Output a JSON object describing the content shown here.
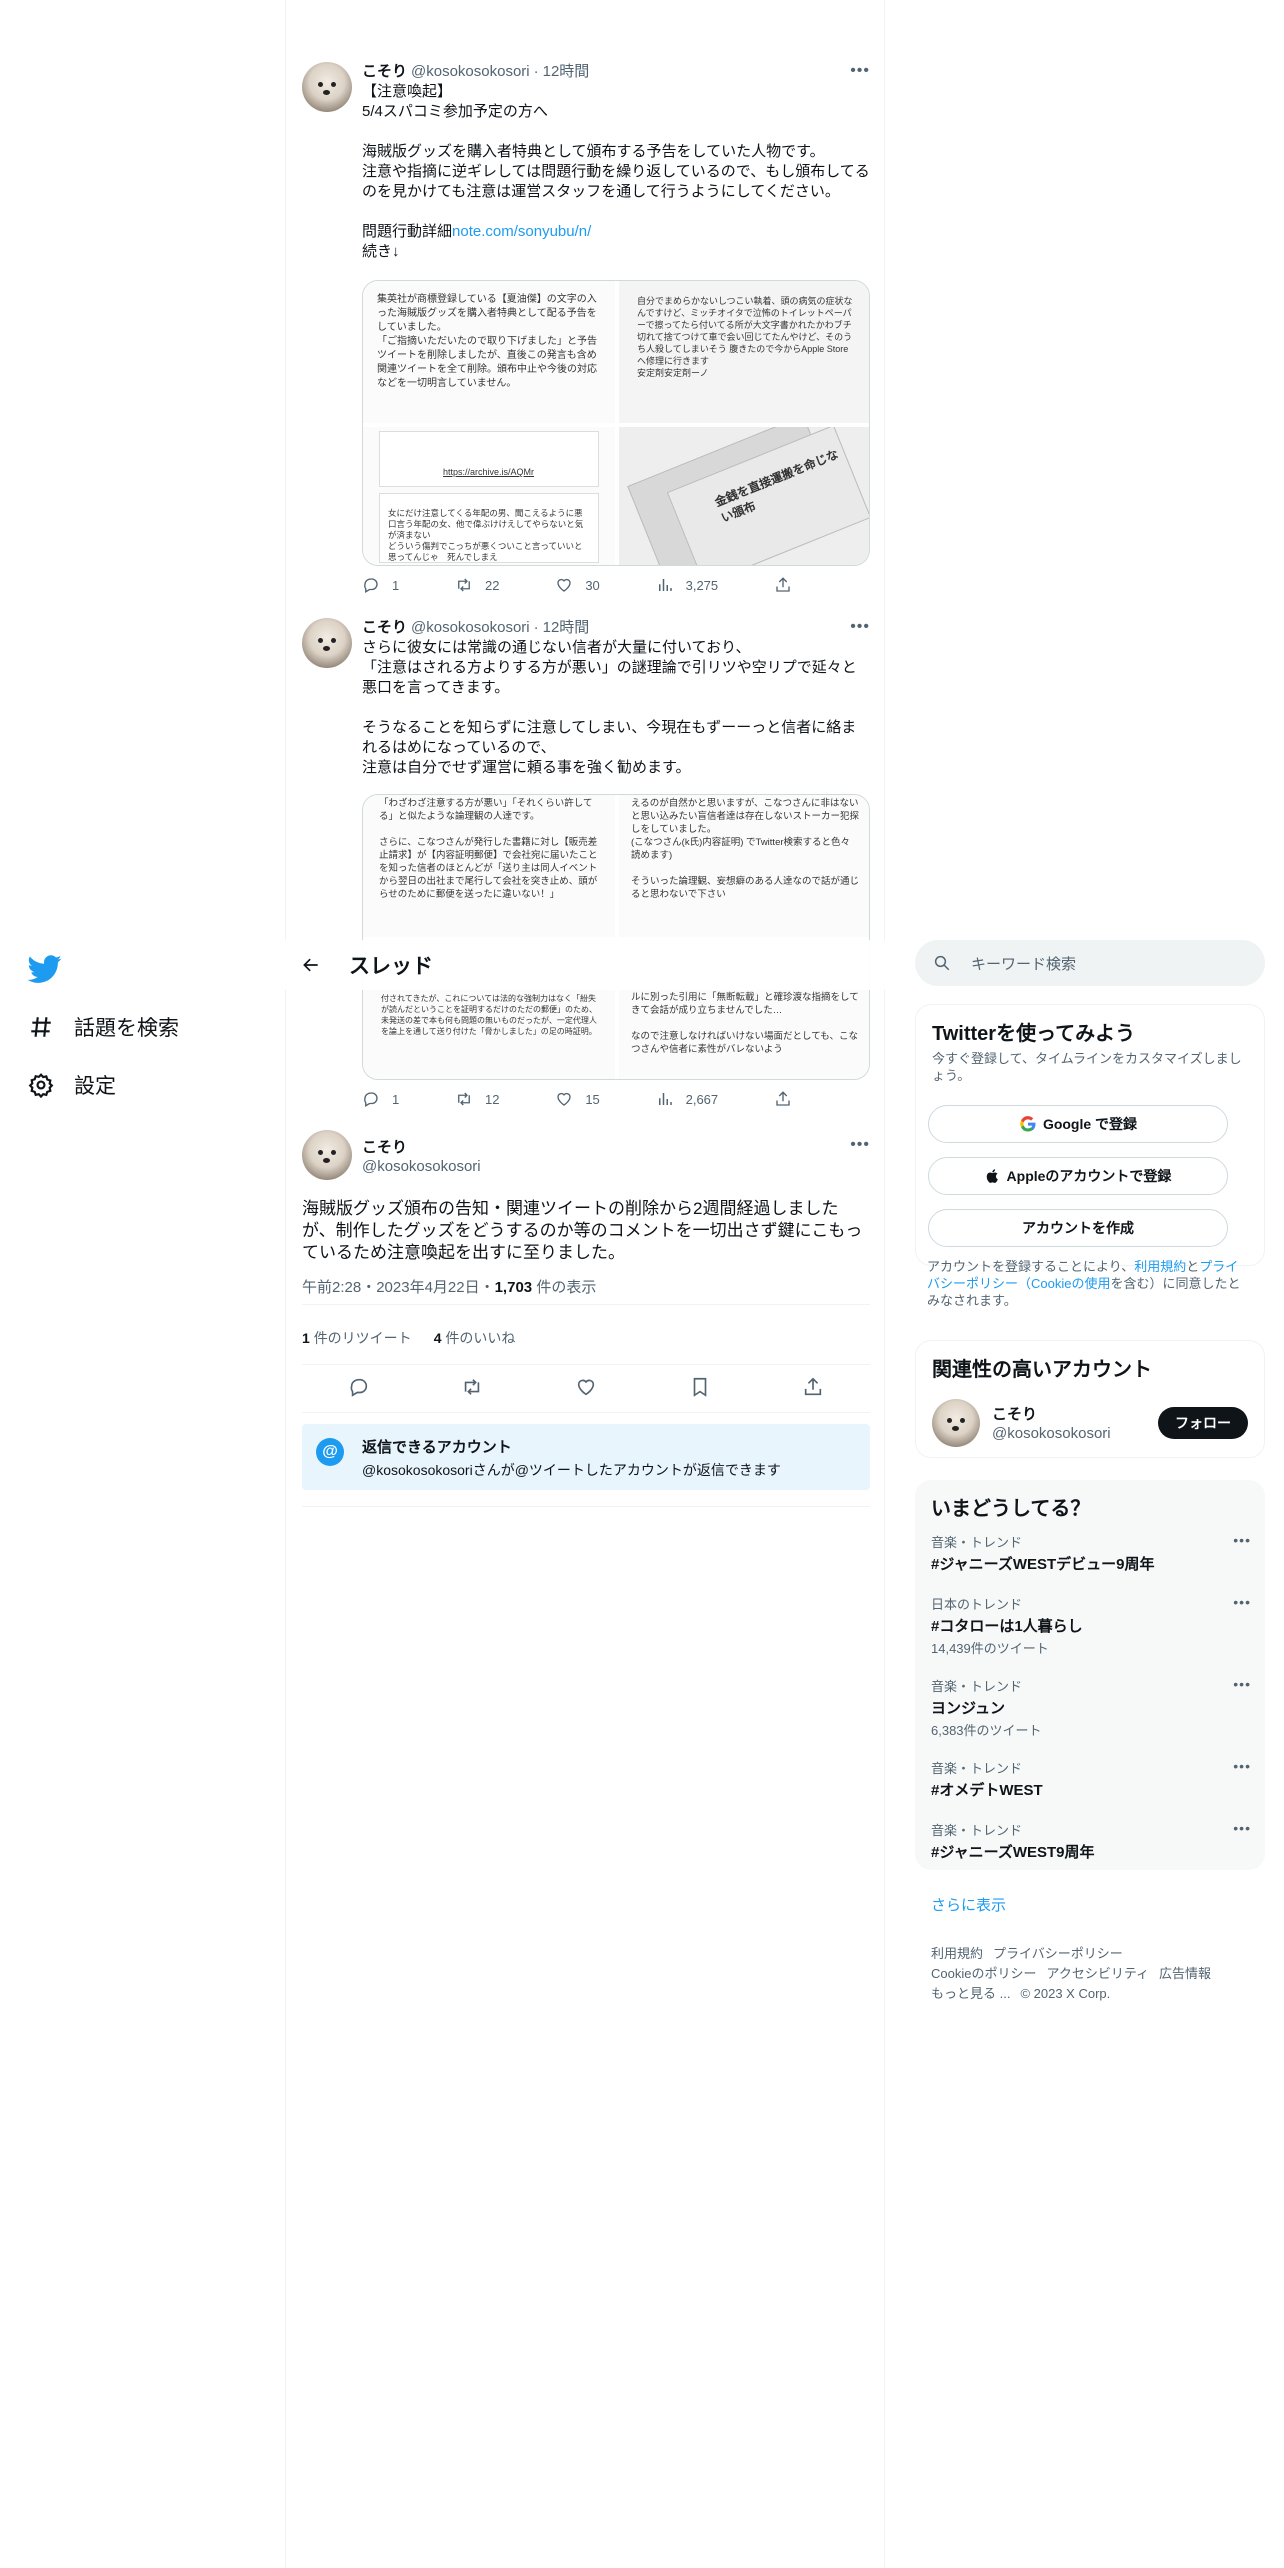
{
  "nav": {
    "explore_label": "話題を検索",
    "settings_label": "設定"
  },
  "thread": {
    "title": "スレッド"
  },
  "tweets": [
    {
      "name": "こそり",
      "handle": "@kosokosokosori",
      "dot": "·",
      "time": "12時間",
      "text": "【注意喚起】\n5/4スパコミ参加予定の方へ\n\n海賊版グッズを購入者特典として頒布する予告をしていた人物です。\n注意や指摘に逆ギレしては問題行動を繰り返しているので、もし頒布してるのを見かけても注意は運営スタッフを通して行うようにしてください。\n\n問題行動詳細",
      "link": "note.com/sonyubu/n/",
      "text_after": "\n続き↓",
      "media": {
        "cell1": "集英社が商標登録している【夏油傑】の文字の入った海賊版グッズを購入者特典として配る予告をしていました。\n「ご指摘いただいたので取り下げました」と予告ツイートを削除しましたが、直後この発言も含め関連ツイートを全て削除。頒布中止や今後の対応などを一切明言していません。",
        "cell2": "自分でまめらかないしつこい執着、頭の病気の症状なんですけど、ミッチオイタで泣怖のトイレットペーパーで擦ってたら付いてる所が大文字書かれたかわブチ切れて捨てつけて車で会い回じてたんやけど、そのうち人殺してしまいそう 腹きたので今からApple Storeへ修理に行きます\n安定剤安定剤ーノ",
        "cell3": "https://archive.is/AQMr",
        "cell4": "女にだけ注意してくる年配の男、聞こえるように悪口言う年配の女、他で偉ぶけけえしてやらないと気が済まない\nどういう傷判でこっちが悪くついこと言っていいと思ってんじゃ　死んでしまえ",
        "cell5": "金銭を直接運搬を命じない頒布"
      },
      "stats": {
        "replies": "1",
        "retweets": "22",
        "likes": "30",
        "views": "3,275"
      }
    },
    {
      "name": "こそり",
      "handle": "@kosokosokosori",
      "dot": "·",
      "time": "12時間",
      "text": "さらに彼女には常識の通じない信者が大量に付いており、\n「注意はされる方よりする方が悪い」の謎理論で引リツや空リプで延々と悪口を言ってきます。\n\nそうなることを知らずに注意してしまい、今現在もずーーっと信者に絡まれるはめになっているので、\n注意は自分でせず運営に頼る事を強く勧めます。",
      "media": {
        "cell1": "「わざわざ注意する方が悪い」「それくらい許してる」と似たような論理観の人達です。\n\nさらに、こなつさんが発行した書籍に対し【販売差止請求】が【内容証明郵便】で会社宛に届いたことを知った信者のほとんどが「送り主は同人イベントから翌日の出社まで尾行して会社を突き止め、頭がらせのために郵便を送ったに違いない！」",
        "cell2": "えるのが自然かと思いますが、こなつさんに非はないと思い込みたい盲信者達は存在しないストーカー犯探しをしていました。\n(こなつさん(k氏)内容証明) でTwitter検索すると色々読めます)\n\nそういった論理観、妄想癖のある人達なので話が通じると思わないで下さい",
        "cell3": "付されてきたが、これについては法的な強制力はなく「紛失が読んだということを証明するだけのただの郵便」のため、未発送の差で本も何も問題の無いものだったが、一定代理人を論上を通して送り付けた「脅かしました」の足の時証明。",
        "cell4": "ルに別った引用に「無断転載」と確珍渡な指摘をしてきて会話が成り立ちませんでした…\n\nなので注意しなければいけない場面だとしても、こなつさんや信者に素性がバレないよう"
      },
      "stats": {
        "replies": "1",
        "retweets": "12",
        "likes": "15",
        "views": "2,667"
      }
    }
  ],
  "main_tweet": {
    "name": "こそり",
    "handle": "@kosokosokosori",
    "text": "海賊版グッズ頒布の告知・関連ツイートの削除から2週間経過しましたが、制作したグッズをどうするのか等のコメントを一切出さず鍵にこもっているため注意喚起を出すに至りました。",
    "timestamp": "午前2:28・2023年4月22日・",
    "views_count": "1,703",
    "views_label": "件の表示",
    "retweet_count": "1",
    "retweet_label": "件のリツイート",
    "like_count": "4",
    "like_label": "件のいいね",
    "reply_title": "返信できるアカウント",
    "reply_desc": "@kosokosokosoriさんが@ツイートしたアカウントが返信できます"
  },
  "sidebar": {
    "search_placeholder": "キーワード検索",
    "signup": {
      "title": "Twitterを使ってみよう",
      "subtitle": "今すぐ登録して、タイムラインをカスタマイズしましょう。",
      "google_label": "Google で登録",
      "apple_label": "Appleのアカウントで登録",
      "create_label": "アカウントを作成",
      "legal_pre": "アカウントを登録することにより、",
      "legal_terms": "利用規約",
      "legal_and": "と",
      "legal_privacy": "プライバシーポリシー（Cookieの使用",
      "legal_post": "を含む）に同意したとみなされます。"
    },
    "related": {
      "title": "関連性の高いアカウント",
      "name": "こそり",
      "handle": "@kosokosokosori",
      "follow_label": "フォロー"
    },
    "trends": {
      "title": "いまどうしてる？",
      "items": [
        {
          "category": "音楽・トレンド",
          "name": "#ジャニーズWESTデビュー9周年",
          "count": ""
        },
        {
          "category": "日本のトレンド",
          "name": "#コタローは1人暮らし",
          "count": "14,439件のツイート"
        },
        {
          "category": "音楽・トレンド",
          "name": "ヨンジュン",
          "count": "6,383件のツイート"
        },
        {
          "category": "音楽・トレンド",
          "name": "#オメデトWEST",
          "count": ""
        },
        {
          "category": "音楽・トレンド",
          "name": "#ジャニーズWEST9周年",
          "count": ""
        }
      ],
      "show_more": "さらに表示"
    },
    "footer": {
      "terms": "利用規約",
      "privacy": "プライバシーポリシー",
      "cookie": "Cookieのポリシー",
      "accessibility": "アクセシビリティ",
      "ads": "広告情報",
      "more": "もっと見る ...",
      "copyright": "© 2023 X Corp."
    }
  },
  "colors": {
    "accent": "#1d9bf0",
    "text": "#0f1419",
    "muted": "#536471",
    "border": "#eff3f4"
  }
}
